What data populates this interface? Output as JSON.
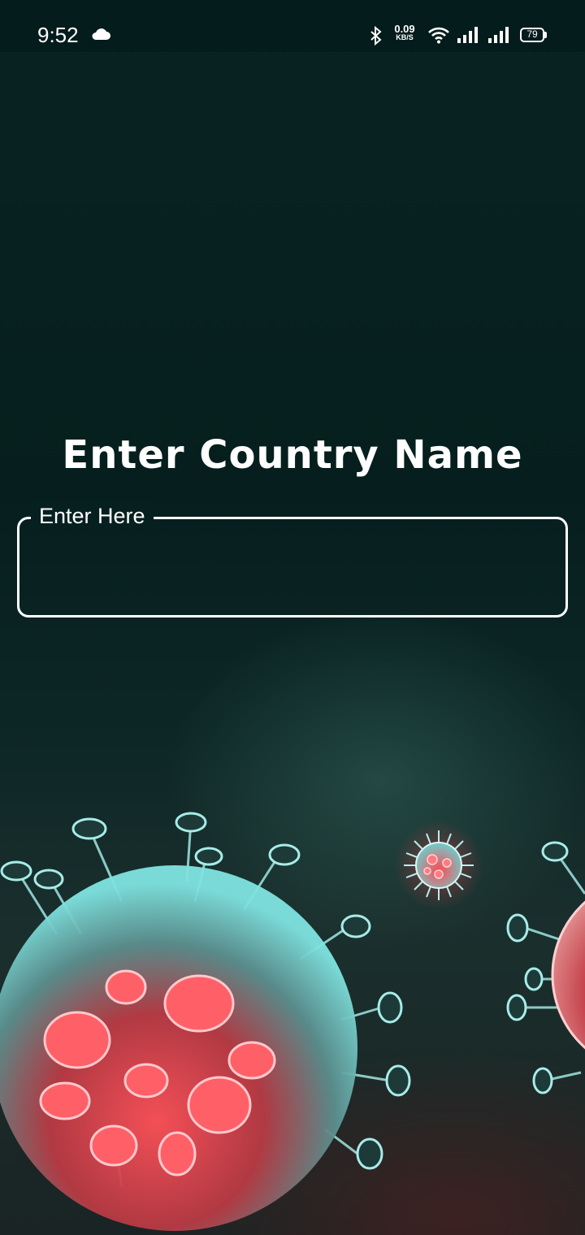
{
  "status_bar": {
    "time": "9:52",
    "net_speed_value": "0.09",
    "net_speed_unit": "KB/S",
    "battery_level": "79",
    "icons": [
      "cloud-icon",
      "bluetooth-icon",
      "wifi-icon",
      "signal-icon",
      "signal-icon",
      "battery-icon"
    ]
  },
  "main": {
    "title": "Enter Country Name",
    "input": {
      "label": "Enter Here",
      "value": ""
    }
  },
  "colors": {
    "background": "#06201f",
    "text": "#ffffff",
    "virus_teal": "#7fe3e0",
    "virus_red": "#e8454d"
  }
}
